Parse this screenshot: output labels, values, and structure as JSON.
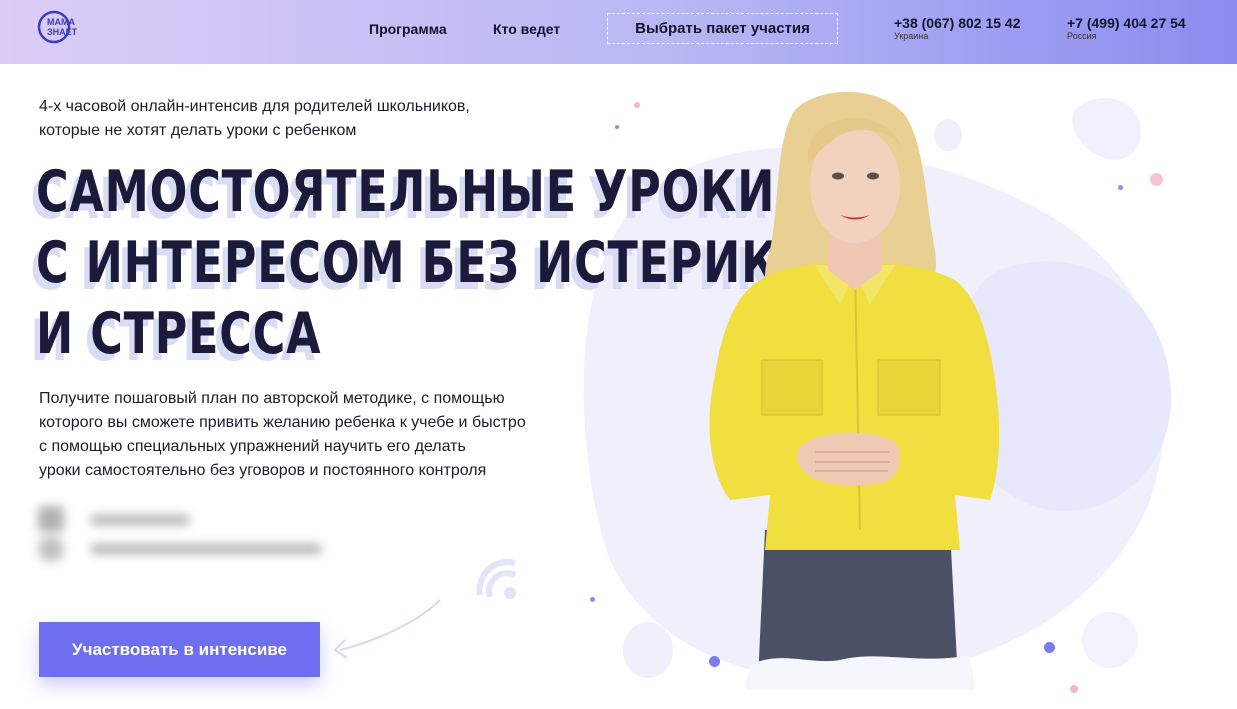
{
  "header": {
    "logo_text": "МАМА ЗНАЕТ",
    "nav": [
      "Программа",
      "Кто ведет"
    ],
    "package_button": "Выбрать пакет участия",
    "phones": [
      {
        "number": "+38 (067) 802 15 42",
        "country": "Украина"
      },
      {
        "number": "+7 (499) 404 27 54",
        "country": "Россия"
      }
    ]
  },
  "hero": {
    "subtitle_line1": "4-х часовой онлайн-интенсив для родителей школьников,",
    "subtitle_line2": "которые не хотят делать уроки с ребенком",
    "headline_line1": "САМОСТОЯТЕЛЬНЫЕ УРОКИ",
    "headline_line2": "С ИНТЕРЕСОМ БЕЗ ИСТЕРИК",
    "headline_line3": "И СТРЕССА",
    "desc_line1": "Получите пошаговый план по авторской методике, с помощью",
    "desc_line2": "которого вы сможете привить желанию ребенка к учебе и быстро",
    "desc_line3": "с помощью специальных упражнений научить его делать",
    "desc_line4": "уроки самостоятельно без уговоров и постоянного контроля",
    "cta_label": "Участвовать в интенсиве"
  },
  "colors": {
    "accent": "#6d6ff0",
    "headline": "#1b1a3a",
    "blob": "#eceefc",
    "blouse": "#f2e045"
  }
}
